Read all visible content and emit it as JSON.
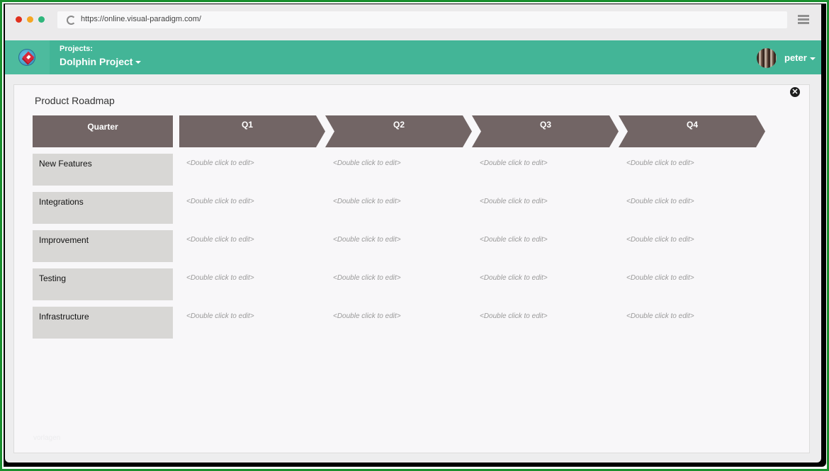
{
  "browser": {
    "url": "https://online.visual-paradigm.com/",
    "traffic_lights": [
      "close",
      "minimize",
      "maximize"
    ],
    "colors": {
      "red": "#e0301e",
      "yellow": "#f5a623",
      "green": "#2fb67b"
    }
  },
  "appbar": {
    "projects_label": "Projects:",
    "project_name": "Dolphin Project",
    "username": "peter",
    "accent_color": "#43b597"
  },
  "roadmap": {
    "title": "Product Roadmap",
    "header_label": "Quarter",
    "header_color": "#726565",
    "quarters": [
      "Q1",
      "Q2",
      "Q3",
      "Q4"
    ],
    "placeholder": "<Double click to edit>",
    "rows": [
      {
        "label": "New Features"
      },
      {
        "label": "Integrations"
      },
      {
        "label": "Improvement"
      },
      {
        "label": "Testing"
      },
      {
        "label": "Infrastructure"
      }
    ]
  },
  "watermark": "vorlagen"
}
